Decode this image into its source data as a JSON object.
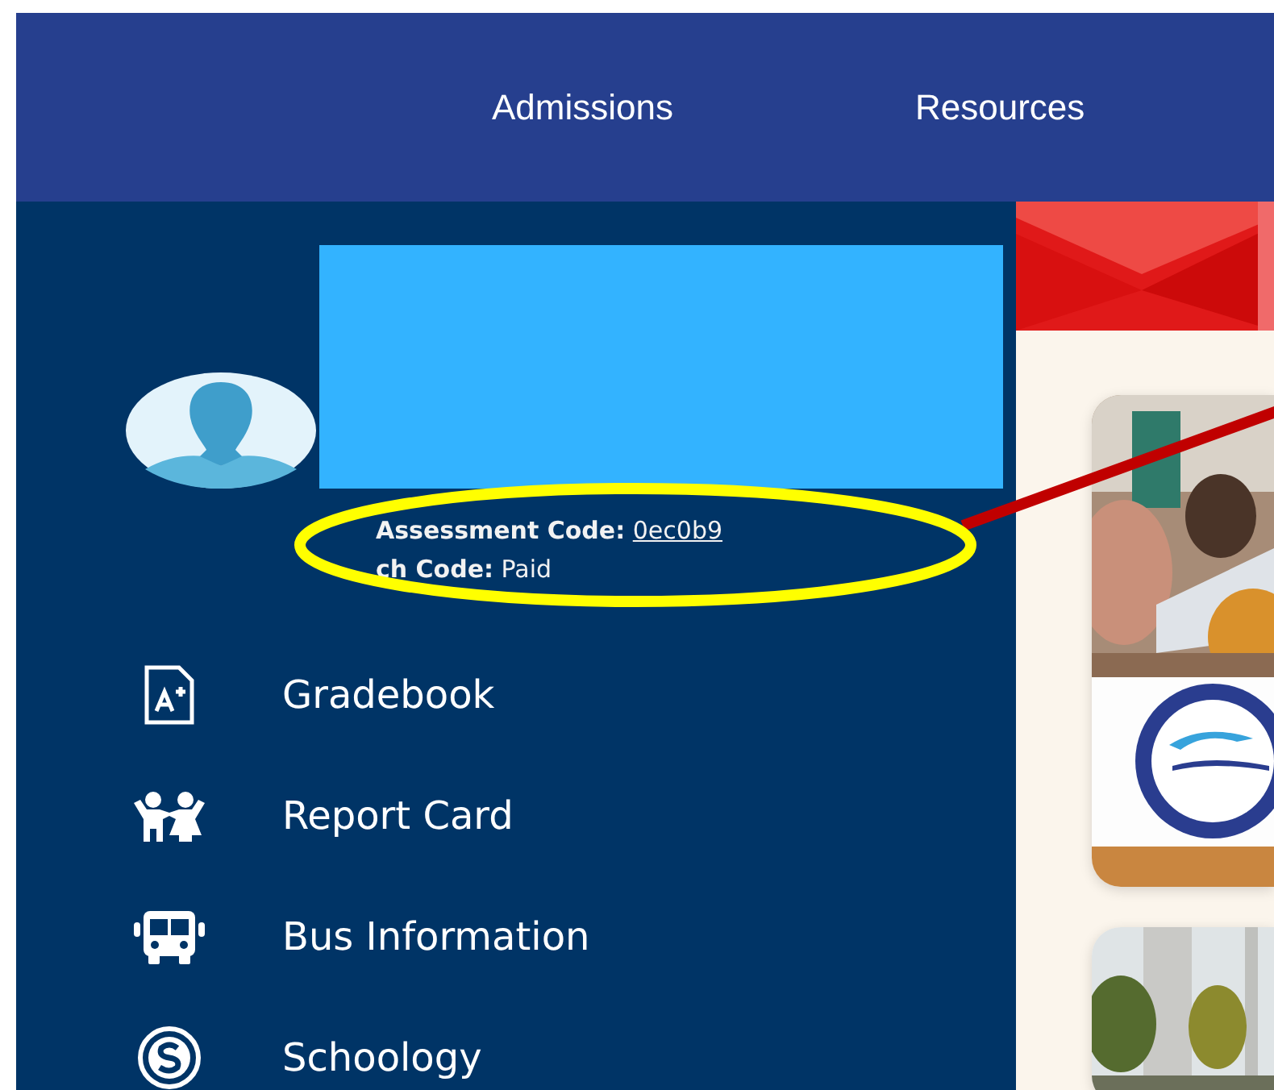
{
  "nav": [
    {
      "label": "Admissions"
    },
    {
      "label": "Resources"
    }
  ],
  "profile": {
    "assessment_label": "Assessment Code:",
    "assessment_code": "0ec0b9",
    "lunch_label": "ch Code:",
    "lunch_value": "Paid"
  },
  "menu": [
    {
      "label": "Gradebook",
      "kind": "gradebook"
    },
    {
      "label": "Report Card",
      "kind": "report"
    },
    {
      "label": "Bus Information",
      "kind": "bus"
    },
    {
      "label": "Schoology",
      "kind": "schoology"
    }
  ]
}
